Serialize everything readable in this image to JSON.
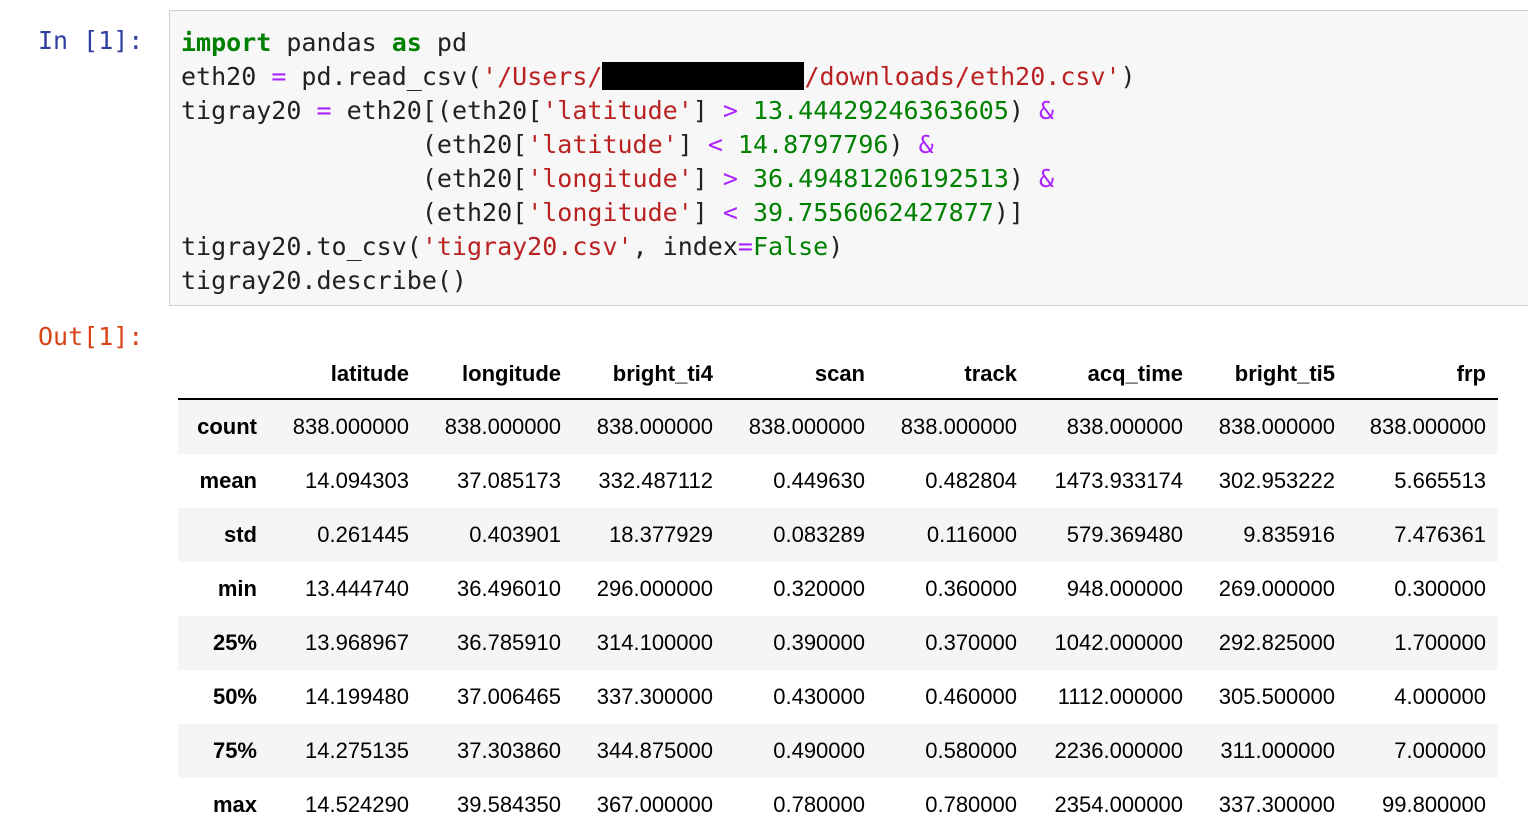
{
  "input_prompt": "In [1]:",
  "output_prompt": "Out[1]:",
  "code_lines": [
    [
      [
        "kw",
        "import"
      ],
      [
        "p",
        " pandas "
      ],
      [
        "kw",
        "as"
      ],
      [
        "p",
        " pd"
      ]
    ],
    [
      [
        "p",
        "eth20 "
      ],
      [
        "op",
        "="
      ],
      [
        "p",
        " pd.read_csv("
      ],
      [
        "str",
        "'/Users/"
      ],
      [
        "redact",
        ""
      ],
      [
        "str",
        "/downloads/eth20.csv'"
      ],
      [
        "p",
        ")"
      ]
    ],
    [
      [
        "p",
        "tigray20 "
      ],
      [
        "op",
        "="
      ],
      [
        "p",
        " eth20[(eth20["
      ],
      [
        "str",
        "'latitude'"
      ],
      [
        "p",
        "] "
      ],
      [
        "op",
        ">"
      ],
      [
        "p",
        " "
      ],
      [
        "num",
        "13.44429246363605"
      ],
      [
        "p",
        ") "
      ],
      [
        "op",
        "&"
      ]
    ],
    [
      [
        "p",
        "                (eth20["
      ],
      [
        "str",
        "'latitude'"
      ],
      [
        "p",
        "] "
      ],
      [
        "op",
        "<"
      ],
      [
        "p",
        " "
      ],
      [
        "num",
        "14.8797796"
      ],
      [
        "p",
        ") "
      ],
      [
        "op",
        "&"
      ]
    ],
    [
      [
        "p",
        "                (eth20["
      ],
      [
        "str",
        "'longitude'"
      ],
      [
        "p",
        "] "
      ],
      [
        "op",
        ">"
      ],
      [
        "p",
        " "
      ],
      [
        "num",
        "36.49481206192513"
      ],
      [
        "p",
        ") "
      ],
      [
        "op",
        "&"
      ]
    ],
    [
      [
        "p",
        "                (eth20["
      ],
      [
        "str",
        "'longitude'"
      ],
      [
        "p",
        "] "
      ],
      [
        "op",
        "<"
      ],
      [
        "p",
        " "
      ],
      [
        "num",
        "39.7556062427877"
      ],
      [
        "p",
        ")]"
      ]
    ],
    [
      [
        "p",
        "tigray20.to_csv("
      ],
      [
        "str",
        "'tigray20.csv'"
      ],
      [
        "p",
        ", index"
      ],
      [
        "op",
        "="
      ],
      [
        "bi",
        "False"
      ],
      [
        "p",
        ")"
      ]
    ],
    [
      [
        "p",
        "tigray20.describe()"
      ]
    ]
  ],
  "redacted_icon": "redaction-bar",
  "table": {
    "index_header": "",
    "columns": [
      "latitude",
      "longitude",
      "bright_ti4",
      "scan",
      "track",
      "acq_time",
      "bright_ti5",
      "frp"
    ],
    "rows": [
      {
        "index": "count",
        "values": [
          "838.000000",
          "838.000000",
          "838.000000",
          "838.000000",
          "838.000000",
          "838.000000",
          "838.000000",
          "838.000000"
        ]
      },
      {
        "index": "mean",
        "values": [
          "14.094303",
          "37.085173",
          "332.487112",
          "0.449630",
          "0.482804",
          "1473.933174",
          "302.953222",
          "5.665513"
        ]
      },
      {
        "index": "std",
        "values": [
          "0.261445",
          "0.403901",
          "18.377929",
          "0.083289",
          "0.116000",
          "579.369480",
          "9.835916",
          "7.476361"
        ]
      },
      {
        "index": "min",
        "values": [
          "13.444740",
          "36.496010",
          "296.000000",
          "0.320000",
          "0.360000",
          "948.000000",
          "269.000000",
          "0.300000"
        ]
      },
      {
        "index": "25%",
        "values": [
          "13.968967",
          "36.785910",
          "314.100000",
          "0.390000",
          "0.370000",
          "1042.000000",
          "292.825000",
          "1.700000"
        ]
      },
      {
        "index": "50%",
        "values": [
          "14.199480",
          "37.006465",
          "337.300000",
          "0.430000",
          "0.460000",
          "1112.000000",
          "305.500000",
          "4.000000"
        ]
      },
      {
        "index": "75%",
        "values": [
          "14.275135",
          "37.303860",
          "344.875000",
          "0.490000",
          "0.580000",
          "2236.000000",
          "311.000000",
          "7.000000"
        ]
      },
      {
        "index": "max",
        "values": [
          "14.524290",
          "39.584350",
          "367.000000",
          "0.780000",
          "0.780000",
          "2354.000000",
          "337.300000",
          "99.800000"
        ]
      }
    ]
  },
  "colors": {
    "prompt_in": "#303f9f",
    "prompt_out": "#d84315",
    "keyword": "#008000",
    "operator": "#aa22ff",
    "string": "#ba2121",
    "number": "#008000",
    "cell_background": "#f7f7f7",
    "cell_border": "#cfcfcf",
    "table_stripe": "#f5f5f5"
  }
}
